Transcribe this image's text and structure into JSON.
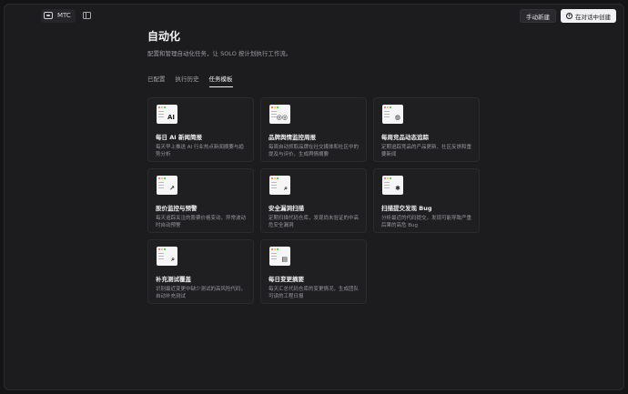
{
  "topbar": {
    "project_name": "MTC",
    "manual_create": "手动新建",
    "chat_create": "在对话中创建"
  },
  "page": {
    "title": "自动化",
    "description": "配置和管理自动化任务，让 SOLO 按计划执行工作流。"
  },
  "tabs": [
    {
      "label": "已配置",
      "active": false
    },
    {
      "label": "执行历史",
      "active": false
    },
    {
      "label": "任务模板",
      "active": true
    }
  ],
  "cards": [
    {
      "title": "每日 AI 新闻简报",
      "desc": "每天早上推送 AI 行业热点新闻摘要与趋势分析",
      "icon": "ai-text-icon",
      "glyph": "AI"
    },
    {
      "title": "品牌舆情监控周报",
      "desc": "每周自动抓取品牌在社交媒体和社区中的提及与评价，生成舆情摘要",
      "icon": "glasses-icon",
      "glyph": "◎◎"
    },
    {
      "title": "每周竞品动态追踪",
      "desc": "定期追踪竞品的产品更新、社区反馈和重要新闻",
      "icon": "robot-icon",
      "glyph": "◍"
    },
    {
      "title": "股价监控与预警",
      "desc": "每天追踪关注的股票价格变动，异常波动时自动预警",
      "icon": "trend-chart-icon",
      "glyph": "↗"
    },
    {
      "title": "安全漏洞扫描",
      "desc": "定期扫描代码仓库，发现尚未验证的中高危安全漏洞",
      "icon": "search-icon",
      "glyph": "⌕"
    },
    {
      "title": "扫描提交发现 Bug",
      "desc": "分析最近的代码提交，发现可能导致严重后果的高危 Bug",
      "icon": "bug-icon",
      "glyph": "✱"
    },
    {
      "title": "补充测试覆盖",
      "desc": "识别最近变更中缺少测试的高风险代码，自动补充测试",
      "icon": "test-search-icon",
      "glyph": "⌕"
    },
    {
      "title": "每日变更摘要",
      "desc": "每天汇总代码仓库的变更情况，生成团队可读的工程日报",
      "icon": "document-icon",
      "glyph": "▤"
    }
  ]
}
